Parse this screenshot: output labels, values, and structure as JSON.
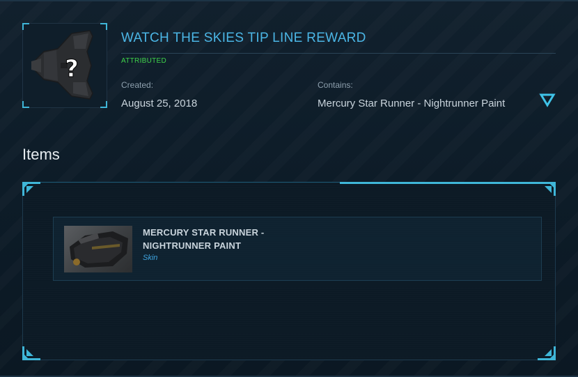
{
  "pledge": {
    "title": "WATCH THE SKIES TIP LINE REWARD",
    "status": "ATTRIBUTED",
    "created_label": "Created:",
    "created_value": "August 25, 2018",
    "contains_label": "Contains:",
    "contains_value": "Mercury Star Runner - Nightrunner Paint",
    "thumbnail_icon": "question-mark-ship-icon",
    "toggle_icon": "chevron-down-triangle-icon"
  },
  "items_section": {
    "heading": "Items",
    "items": [
      {
        "name": "MERCURY STAR RUNNER - NIGHTRUNNER PAINT",
        "type": "Skin"
      }
    ]
  },
  "colors": {
    "accent": "#3fb6d8",
    "title": "#4bb6e6",
    "status": "#3fd34a",
    "item_type": "#3fa4e0",
    "background": "#0c1a26"
  }
}
